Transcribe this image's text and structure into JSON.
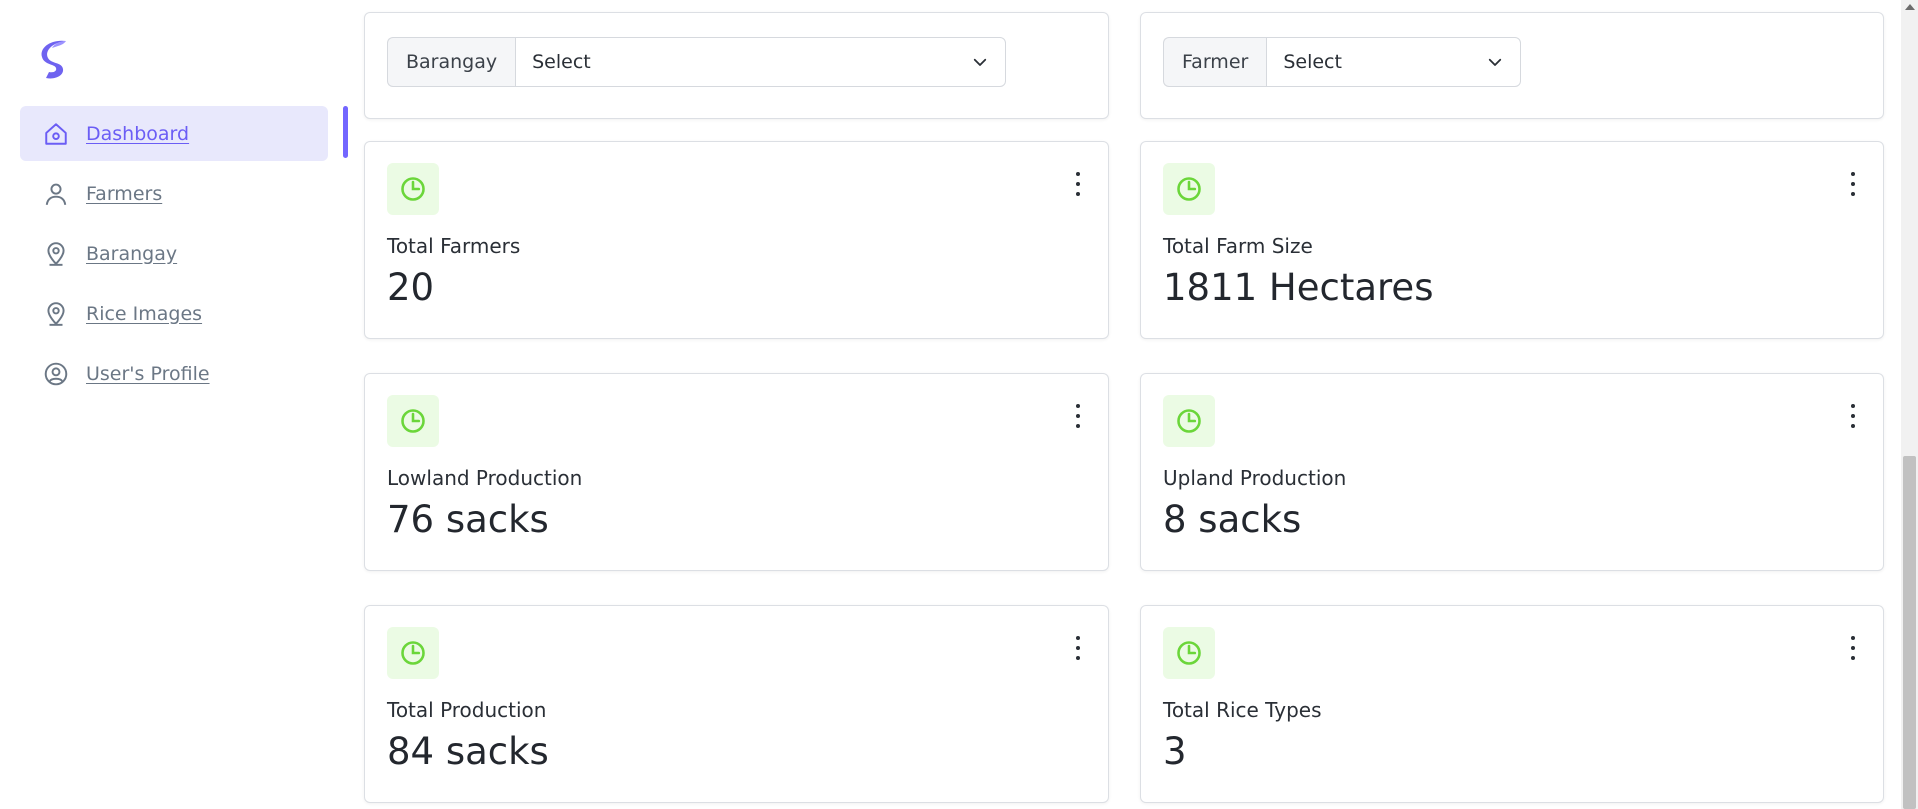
{
  "sidebar": {
    "items": [
      {
        "label": "Dashboard",
        "icon": "home-icon",
        "active": true
      },
      {
        "label": "Farmers",
        "icon": "user-icon"
      },
      {
        "label": "Barangay",
        "icon": "map-pin-icon"
      },
      {
        "label": "Rice Images",
        "icon": "map-pin-icon"
      },
      {
        "label": "User's Profile",
        "icon": "user-circle-icon"
      }
    ]
  },
  "filters": {
    "barangay": {
      "label": "Barangay",
      "value": "Select"
    },
    "farmer": {
      "label": "Farmer",
      "value": "Select"
    }
  },
  "stats": [
    {
      "title": "Total Farmers",
      "value": "20"
    },
    {
      "title": "Total Farm Size",
      "value": "1811 Hectares"
    },
    {
      "title": "Lowland Production",
      "value": "76 sacks"
    },
    {
      "title": "Upland Production",
      "value": "8 sacks"
    },
    {
      "title": "Total Production",
      "value": "84 sacks"
    },
    {
      "title": "Total Rice Types",
      "value": "3"
    }
  ],
  "colors": {
    "accent": "#7366ff",
    "active_bg": "#e8e8fc",
    "icon_green": "#6bd63a",
    "icon_bg": "#ebfbe4"
  }
}
